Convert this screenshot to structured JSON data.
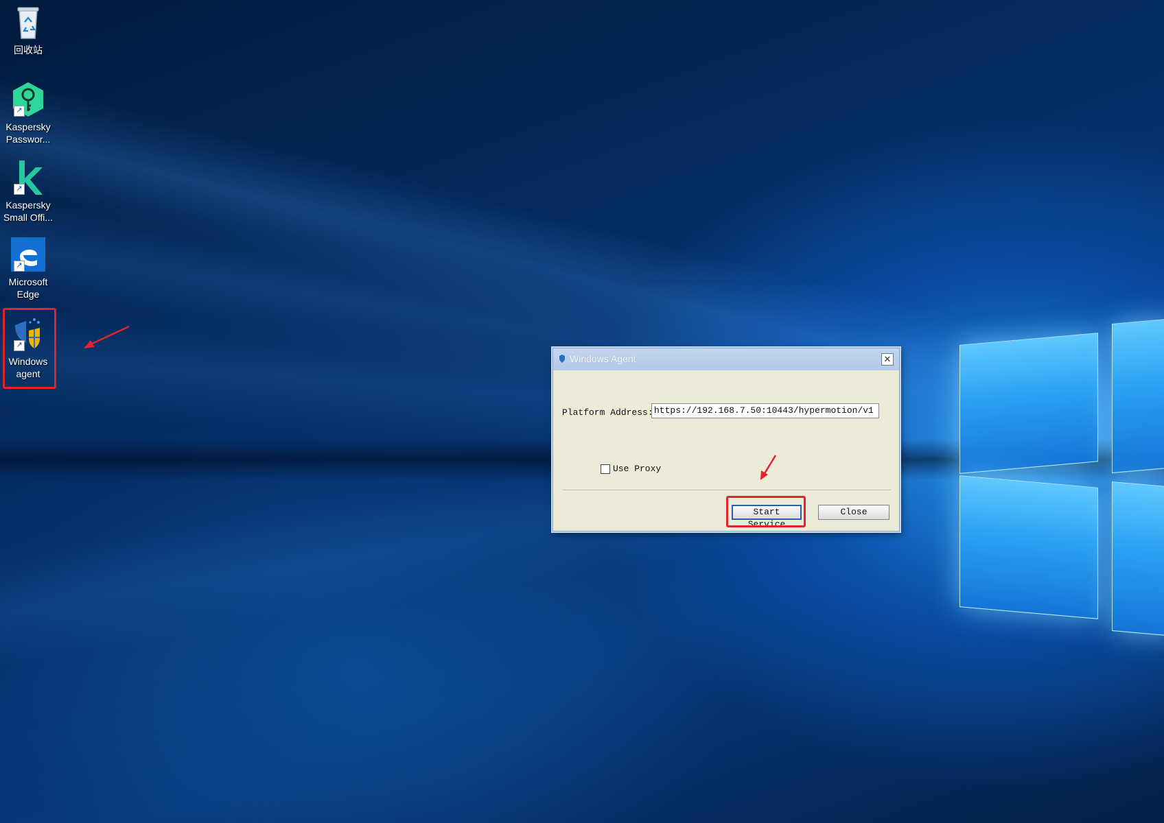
{
  "desktop": {
    "icons": [
      {
        "label": "回收站",
        "icon": "recycle-bin-icon"
      },
      {
        "label": "Kaspersky Passwor...",
        "icon": "kaspersky-password-icon"
      },
      {
        "label": "Kaspersky Small Offi...",
        "icon": "kaspersky-small-office-icon"
      },
      {
        "label": "Microsoft Edge",
        "icon": "edge-icon"
      },
      {
        "label": "Windows agent",
        "icon": "windows-agent-icon"
      }
    ]
  },
  "dialog": {
    "title": "Windows Agent",
    "platform_label": "Platform Address:",
    "platform_value": "https://192.168.7.50:10443/hypermotion/v1",
    "use_proxy_label": "Use Proxy",
    "use_proxy_checked": false,
    "start_label": "Start Service",
    "close_label": "Close"
  },
  "colors": {
    "highlight": "#e3232b",
    "dialog_bg": "#ecebd8",
    "titlebar": "#b2c9e8"
  }
}
